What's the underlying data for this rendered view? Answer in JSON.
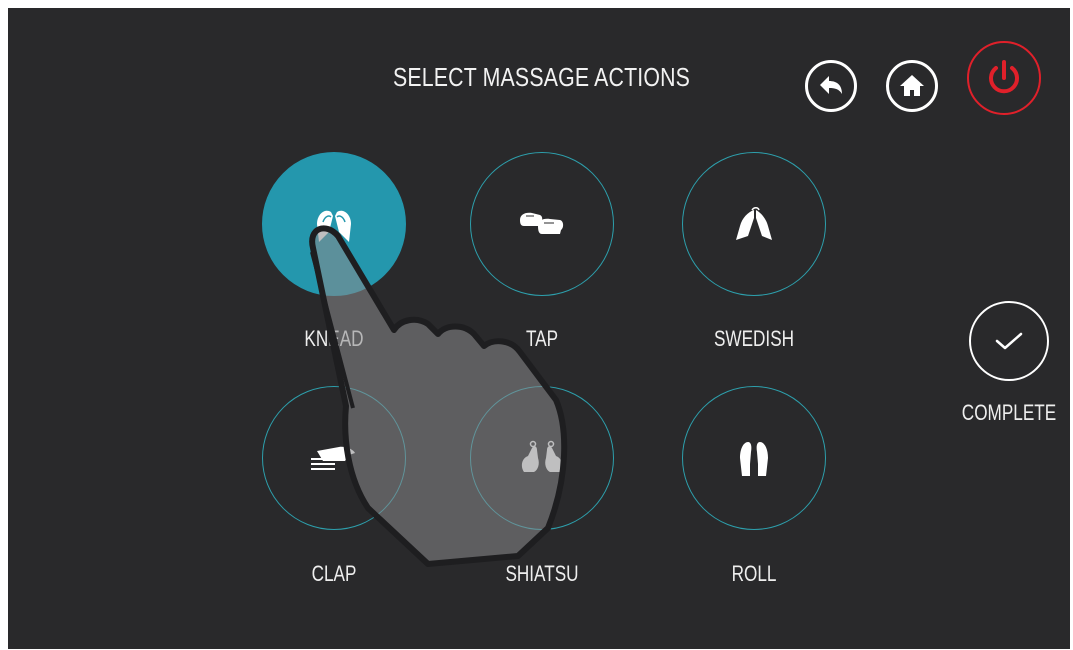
{
  "header": {
    "title": "SELECT MASSAGE ACTIONS",
    "buttons": [
      {
        "name": "back",
        "icon": "back-arrow-icon"
      },
      {
        "name": "home",
        "icon": "home-icon"
      },
      {
        "name": "power",
        "icon": "power-icon",
        "color": "#e0202a"
      }
    ]
  },
  "actions": [
    {
      "label": "KNEAD",
      "icon": "knead-hands-icon",
      "selected": true
    },
    {
      "label": "TAP",
      "icon": "tap-fists-icon",
      "selected": false
    },
    {
      "label": "SWEDISH",
      "icon": "swedish-hands-icon",
      "selected": false
    },
    {
      "label": "CLAP",
      "icon": "clap-hand-icon",
      "selected": false
    },
    {
      "label": "SHIATSU",
      "icon": "shiatsu-thumbs-icon",
      "selected": false
    },
    {
      "label": "ROLL",
      "icon": "roll-hands-icon",
      "selected": false
    }
  ],
  "complete": {
    "label": "COMPLETE",
    "icon": "checkmark-icon"
  },
  "colors": {
    "background": "#29292b",
    "accent": "#2497ad",
    "ring": "#2d9fac",
    "power": "#e0202a"
  }
}
